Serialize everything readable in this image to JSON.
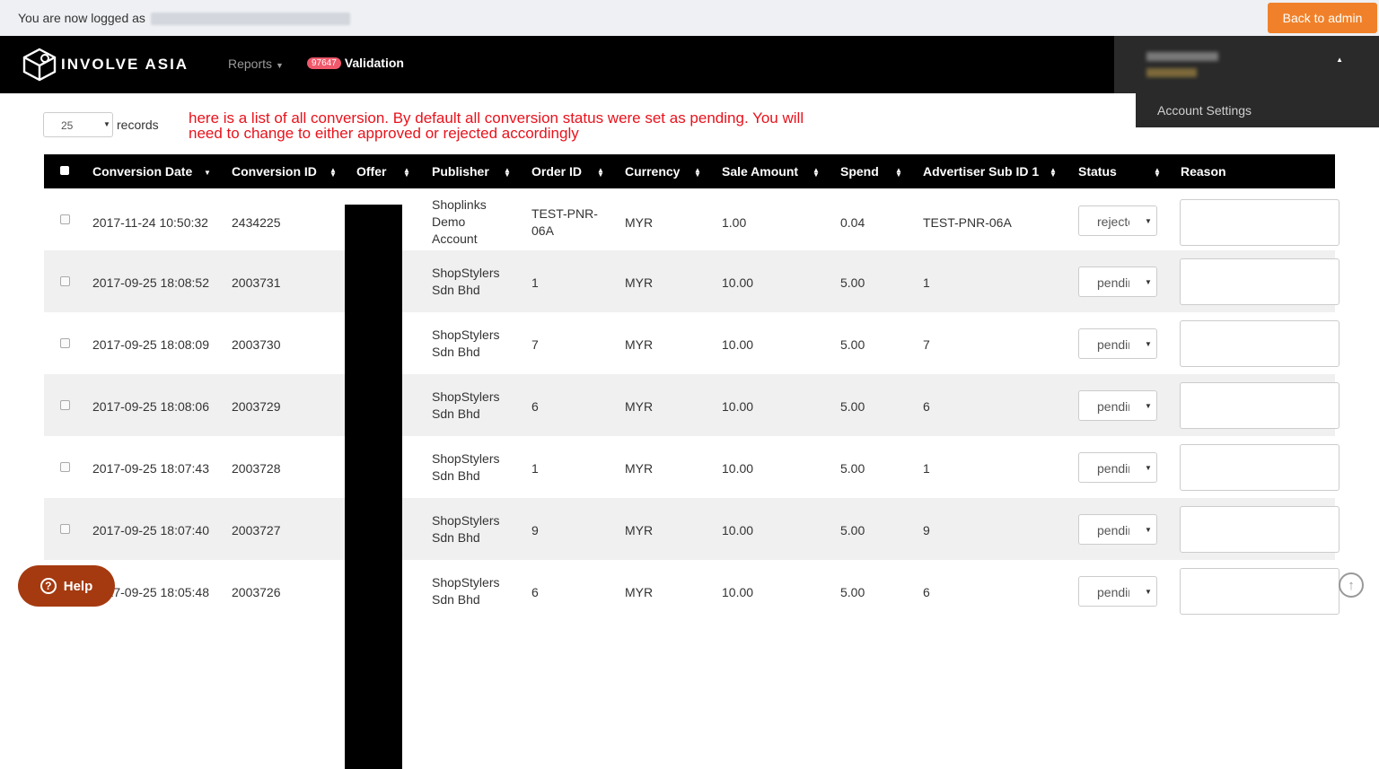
{
  "top": {
    "logged_text": "You are now logged as",
    "back_admin": "Back to admin"
  },
  "nav": {
    "brand": "INVOLVE ASIA",
    "reports": "Reports",
    "validation_badge": "97647",
    "validation": "Validation",
    "account_settings": "Account Settings"
  },
  "records": {
    "value": "25",
    "label": "records"
  },
  "annotation": "here is a list of all conversion. By default all conversion status were set as pending. You will need to change to either approved or rejected accordingly",
  "columns": [
    "Conversion Date",
    "Conversion ID",
    "Offer",
    "Publisher",
    "Order ID",
    "Currency",
    "Sale Amount",
    "Spend",
    "Advertiser Sub ID 1",
    "Status",
    "Reason"
  ],
  "rows": [
    {
      "date": "2017-11-24 10:50:32",
      "id": "2434225",
      "publisher": [
        "Shoplinks",
        "Demo",
        "Account"
      ],
      "order": [
        "TEST-PNR-",
        "06A"
      ],
      "currency": "MYR",
      "sale": "1.00",
      "spend": "0.04",
      "sub": "TEST-PNR-06A",
      "status": "rejected"
    },
    {
      "date": "2017-09-25 18:08:52",
      "id": "2003731",
      "publisher": [
        "ShopStylers",
        "Sdn Bhd"
      ],
      "order": [
        "1"
      ],
      "currency": "MYR",
      "sale": "10.00",
      "spend": "5.00",
      "sub": "1",
      "status": "pending"
    },
    {
      "date": "2017-09-25 18:08:09",
      "id": "2003730",
      "publisher": [
        "ShopStylers",
        "Sdn Bhd"
      ],
      "order": [
        "7"
      ],
      "currency": "MYR",
      "sale": "10.00",
      "spend": "5.00",
      "sub": "7",
      "status": "pending"
    },
    {
      "date": "2017-09-25 18:08:06",
      "id": "2003729",
      "publisher": [
        "ShopStylers",
        "Sdn Bhd"
      ],
      "order": [
        "6"
      ],
      "currency": "MYR",
      "sale": "10.00",
      "spend": "5.00",
      "sub": "6",
      "status": "pending"
    },
    {
      "date": "2017-09-25 18:07:43",
      "id": "2003728",
      "publisher": [
        "ShopStylers",
        "Sdn Bhd"
      ],
      "order": [
        "1"
      ],
      "currency": "MYR",
      "sale": "10.00",
      "spend": "5.00",
      "sub": "1",
      "status": "pending"
    },
    {
      "date": "2017-09-25 18:07:40",
      "id": "2003727",
      "publisher": [
        "ShopStylers",
        "Sdn Bhd"
      ],
      "order": [
        "9"
      ],
      "currency": "MYR",
      "sale": "10.00",
      "spend": "5.00",
      "sub": "9",
      "status": "pending"
    },
    {
      "date": "2017-09-25 18:05:48",
      "id": "2003726",
      "publisher": [
        "ShopStylers",
        "Sdn Bhd"
      ],
      "order": [
        "6"
      ],
      "currency": "MYR",
      "sale": "10.00",
      "spend": "5.00",
      "sub": "6",
      "status": "pending"
    }
  ],
  "help": "Help",
  "icons": {
    "logo": "cube-logo-icon",
    "help": "question-circle-icon",
    "scroll_top": "arrow-up-circle-icon"
  },
  "colors": {
    "accent": "#f0812a",
    "badge": "#f0596b",
    "annotation": "#e8121c",
    "help": "#a53a10"
  }
}
